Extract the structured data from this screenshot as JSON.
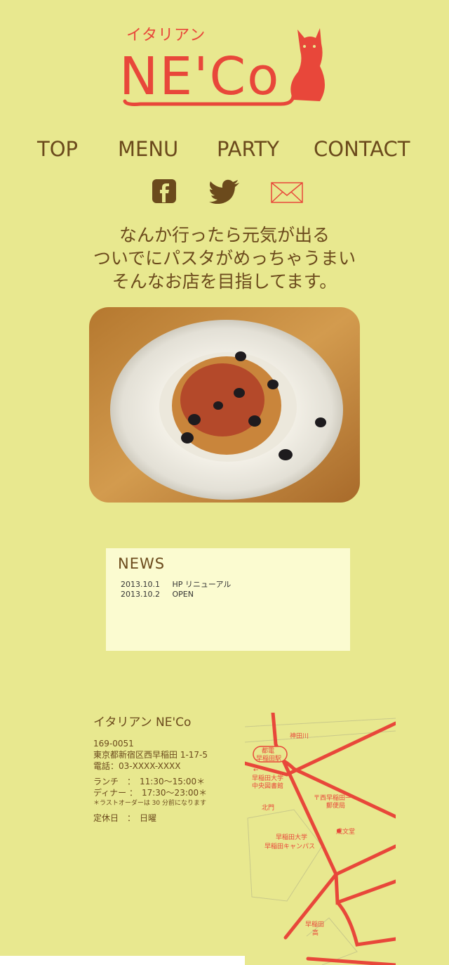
{
  "brand": {
    "small": "イタリアン",
    "main": "NE'Co"
  },
  "nav": [
    "TOP",
    "MENU",
    "PARTY",
    "CONTACT"
  ],
  "social": {
    "facebook": "facebook-icon",
    "twitter": "twitter-icon",
    "mail": "mail-icon"
  },
  "catch_lines": [
    "なんか行ったら元気が出る",
    "ついでにパスタがめっちゃうまい",
    "そんなお店を目指してます。"
  ],
  "news": {
    "title": "NEWS",
    "items": [
      {
        "date": "2013.10.1",
        "text": "HP リニューアル"
      },
      {
        "date": "2013.10.2",
        "text": "OPEN"
      }
    ]
  },
  "info": {
    "name": "イタリアン NE'Co",
    "zip": "169-0051",
    "address": "東京都新宿区西早稲田 1-17-5",
    "tel": "電話：03-XXXX-XXXX",
    "lunch": "ランチ　：　11:30～15:00＊",
    "dinner": "ディナー ：　17:30～23:00＊",
    "note": "＊ラストオーダーは 30 分前になります",
    "holiday": "定休日　：　日曜"
  },
  "map_labels": {
    "river": "神田川",
    "station": "都電\n早稲田駅",
    "library": "早稲田大学\n中央図書館",
    "post": "〒西早稲田一\n郵便局",
    "gate": "北門",
    "shop": "成文堂",
    "campus": "早稲田大学\n早稲田キャンパス",
    "school": "早稲田\n高"
  },
  "colors": {
    "background": "#e8e88f",
    "accent": "#e8473a",
    "text": "#6b4a1c",
    "news_bg": "#fbfbd0"
  }
}
